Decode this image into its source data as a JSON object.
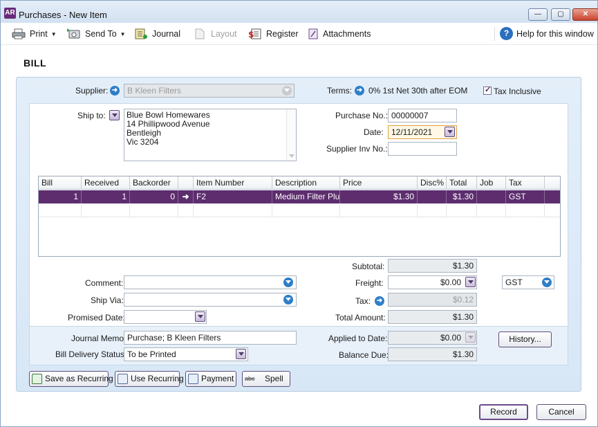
{
  "window": {
    "app_badge": "AR",
    "title": "Purchases - New Item",
    "minimize": "—",
    "maximize": "▢",
    "close": "✕"
  },
  "toolbar": {
    "print": "Print",
    "send_to": "Send To",
    "journal": "Journal",
    "layout": "Layout",
    "register": "Register",
    "attachments": "Attachments",
    "help": "Help for this window",
    "help_glyph": "?"
  },
  "form": {
    "heading": "BILL",
    "supplier_label": "Supplier:",
    "supplier_value": "B Kleen Filters",
    "terms_label": "Terms:",
    "terms_value": "0% 1st Net 30th after EOM",
    "tax_inclusive_label": "Tax Inclusive",
    "tax_inclusive_checked": true,
    "ship_to_label": "Ship to:",
    "ship_to_lines": [
      "Blue Bowl Homewares",
      "14 Phillipwood Avenue",
      "Bentleigh",
      "Vic 3204"
    ],
    "purchase_no_label": "Purchase No.:",
    "purchase_no_value": "00000007",
    "date_label": "Date:",
    "date_value": "12/11/2021",
    "supplier_inv_label": "Supplier Inv No.:",
    "supplier_inv_value": ""
  },
  "grid": {
    "columns": [
      "Bill",
      "Received",
      "Backorder",
      "",
      "Item Number",
      "Description",
      "Price",
      "Disc%",
      "Total",
      "Job",
      "Tax"
    ],
    "rows": [
      {
        "bill": "1",
        "received": "1",
        "backorder": "0",
        "item_number": "F2",
        "description": "Medium Filter Plug",
        "price": "$1.30",
        "disc": "",
        "total": "$1.30",
        "job": "",
        "tax": "GST"
      }
    ]
  },
  "footer": {
    "comment_label": "Comment:",
    "comment_value": "",
    "ship_via_label": "Ship Via:",
    "ship_via_value": "",
    "promised_date_label": "Promised Date:",
    "promised_date_value": "",
    "subtotal_label": "Subtotal:",
    "subtotal_value": "$1.30",
    "freight_label": "Freight:",
    "freight_value": "$0.00",
    "freight_tax_code": "GST",
    "tax_label": "Tax:",
    "tax_value": "$0.12",
    "total_amount_label": "Total Amount:",
    "total_amount_value": "$1.30",
    "journal_memo_label": "Journal Memo:",
    "journal_memo_value": "Purchase; B Kleen Filters",
    "delivery_status_label": "Bill Delivery Status:",
    "delivery_status_value": "To be Printed",
    "applied_label": "Applied to Date:",
    "applied_value": "$0.00",
    "balance_label": "Balance Due:",
    "balance_value": "$1.30",
    "history_button": "History..."
  },
  "actions": {
    "save_recurring": "Save as Recurring",
    "use_recurring": "Use Recurring",
    "payment": "Payment",
    "spell": "Spell",
    "spell_badge": "abc",
    "record": "Record",
    "cancel": "Cancel"
  },
  "colors": {
    "selected_row": "#5d2d6e",
    "panel_blue": "#dce9f7",
    "accent_blue": "#2e7fc8"
  }
}
